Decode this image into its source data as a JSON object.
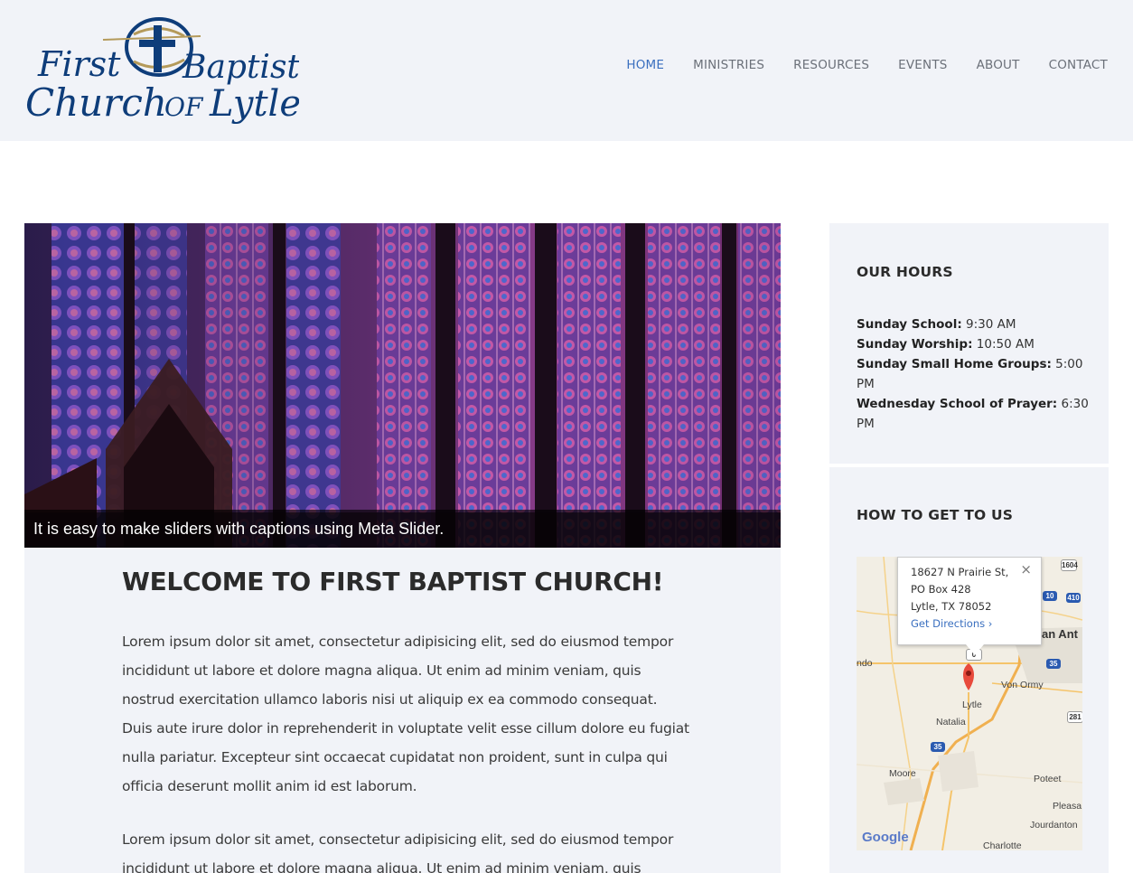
{
  "logo": {
    "line1a": "First",
    "line1b": "Baptist",
    "line2a": "Church",
    "line2b": "OF",
    "line2c": "Lytle"
  },
  "nav": [
    {
      "label": "HOME",
      "active": true
    },
    {
      "label": "MINISTRIES"
    },
    {
      "label": "RESOURCES"
    },
    {
      "label": "EVENTS"
    },
    {
      "label": "ABOUT"
    },
    {
      "label": "CONTACT"
    }
  ],
  "slider": {
    "caption": "It is easy to make sliders with captions using Meta Slider."
  },
  "main": {
    "title": "WELCOME TO FIRST BAPTIST CHURCH!",
    "para1": "Lorem ipsum dolor sit amet, consectetur adipisicing elit, sed do eiusmod tempor incididunt ut labore et dolore magna aliqua. Ut enim ad minim veniam, quis nostrud exercitation ullamco laboris nisi ut aliquip ex ea commodo consequat. Duis aute irure dolor in reprehenderit in voluptate velit esse cillum dolore eu fugiat nulla pariatur. Excepteur sint occaecat cupidatat non proident, sunt in culpa qui officia deserunt mollit anim id est laborum.",
    "para2": "Lorem ipsum dolor sit amet, consectetur adipisicing elit, sed do eiusmod tempor incididunt ut labore et dolore magna aliqua. Ut enim ad minim veniam, quis"
  },
  "hours": {
    "title": "OUR HOURS",
    "items": [
      {
        "label": "Sunday School:",
        "value": "9:30 AM"
      },
      {
        "label": "Sunday Worship:",
        "value": "10:50 AM"
      },
      {
        "label": "Sunday Small Home Groups:",
        "value": "5:00 PM"
      },
      {
        "label": "Wednesday School of Prayer:",
        "value": "6:30 PM"
      }
    ]
  },
  "directions": {
    "title": "HOW TO GET TO US",
    "address1": "18627 N Prairie St,",
    "address2": "PO Box 428",
    "address3": "Lytle, TX 78052",
    "link": "Get Directions ›",
    "close": "×",
    "map_labels": [
      "Lytle",
      "Natalia",
      "Von Ormy",
      "Moore",
      "Poteet",
      "Pleasa",
      "Jourdanton",
      "Charlotte",
      "ndo",
      "an Ant",
      "Google"
    ],
    "shields": [
      "1604",
      "10",
      "410",
      "35",
      "281",
      "35",
      "0"
    ]
  }
}
